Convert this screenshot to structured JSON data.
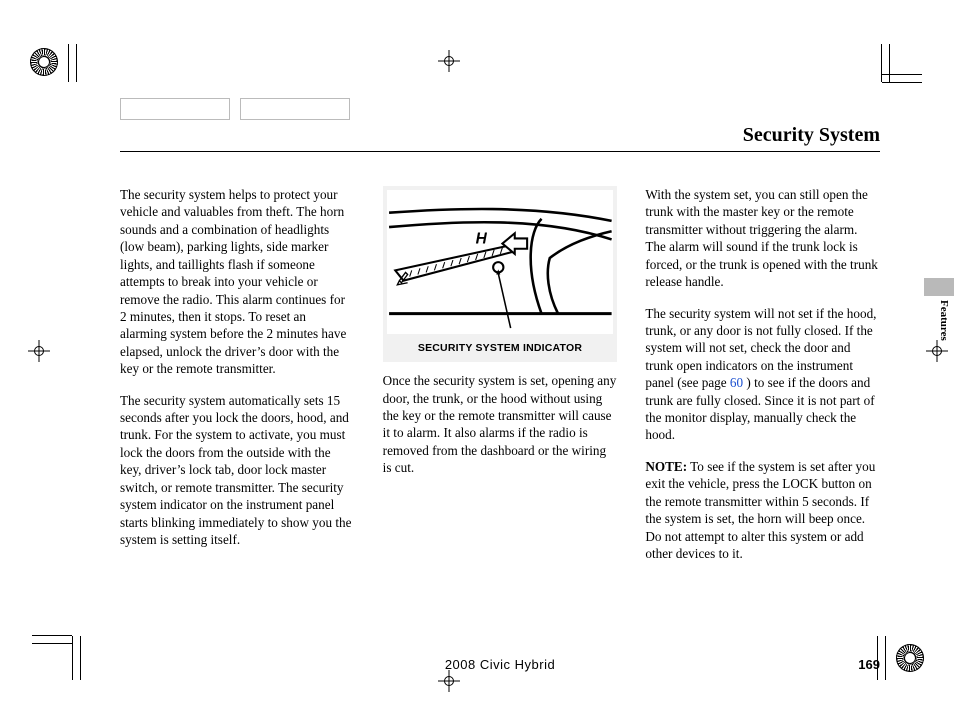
{
  "header": {
    "title": "Security System"
  },
  "sidetab": {
    "label": "Features"
  },
  "footer": {
    "model": "2008  Civic  Hybrid",
    "page_number": "169"
  },
  "diagram": {
    "caption": "SECURITY SYSTEM INDICATOR",
    "gauge_letter": "H"
  },
  "columns": {
    "left": {
      "p1": "The security system helps to protect your vehicle and valuables from theft. The horn sounds and a combination of headlights (low beam), parking lights, side marker lights, and taillights flash if someone attempts to break into your vehicle or remove the radio. This alarm continues for 2 minutes, then it stops. To reset an alarming system before the 2 minutes have elapsed, unlock the driver’s door with the key or the remote transmitter.",
      "p2": "The security system automatically sets 15 seconds after you lock the doors, hood, and trunk. For the system to activate, you must lock the doors from the outside with the key, driver’s lock tab, door lock master switch, or remote transmitter. The security system indicator on the instrument panel starts blinking immediately to show you the system is setting itself."
    },
    "middle": {
      "p1": "Once the security system is set, opening any door, the trunk, or the hood without using the key or the remote transmitter will cause it to alarm. It also alarms if the radio is removed from the dashboard or the wiring is cut."
    },
    "right": {
      "p1": "With the system set, you can still open the trunk with the master key or the remote transmitter without triggering the alarm. The alarm will sound if the trunk lock is forced, or the trunk is opened with the trunk release handle.",
      "p2_a": "The security system will not set if the hood, trunk, or any door is not fully closed. If the system will not set, check the door and trunk open indicators on the instrument panel (see page ",
      "p2_link": "60",
      "p2_b": " ) to see if the doors and trunk are fully closed. Since it is not part of the monitor display, manually check the hood.",
      "p3_label": "NOTE:",
      "p3_a": " To see if the system is set after you exit the vehicle, press the LOCK button on the remote transmitter within 5 seconds. If the system is set, the horn will beep once.",
      "p3_b": "Do not attempt to alter this system or add other devices to it."
    }
  }
}
